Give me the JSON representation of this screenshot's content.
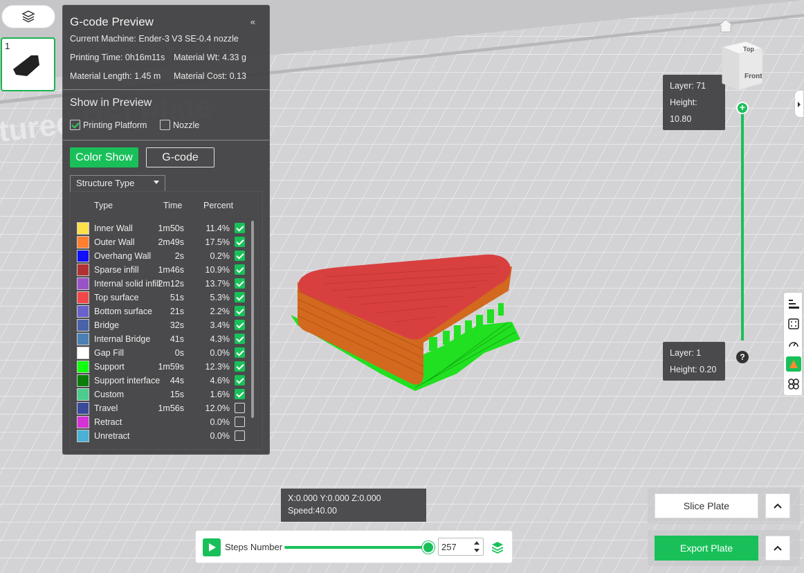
{
  "panel": {
    "title": "G-code Preview",
    "collapse": "«",
    "machine": "Current Machine: Ender-3 V3 SE-0.4 nozzle",
    "printing_time": "Printing Time: 0h16m11s",
    "material_wt": "Material Wt: 4.33 g",
    "material_length": "Material Length: 1.45 m",
    "material_cost": "Material Cost: 0.13",
    "show_in_preview": "Show in Preview",
    "opt_platform": "Printing Platform",
    "opt_nozzle": "Nozzle",
    "btn_color_show": "Color Show",
    "btn_gcode": "G-code",
    "select_value": "Structure Type",
    "hdr_type": "Type",
    "hdr_time": "Time",
    "hdr_percent": "Percent",
    "rows": [
      {
        "name": "Inner Wall",
        "time": "1m50s",
        "pct": "11.4%",
        "color": "#ffe04a",
        "on": true
      },
      {
        "name": "Outer Wall",
        "time": "2m49s",
        "pct": "17.5%",
        "color": "#ff7f2e",
        "on": true
      },
      {
        "name": "Overhang Wall",
        "time": "2s",
        "pct": "0.2%",
        "color": "#1010ff",
        "on": true
      },
      {
        "name": "Sparse infill",
        "time": "1m46s",
        "pct": "10.9%",
        "color": "#b03232",
        "on": true
      },
      {
        "name": "Internal solid infill",
        "time": "2m12s",
        "pct": "13.7%",
        "color": "#9a52c8",
        "on": true
      },
      {
        "name": "Top surface",
        "time": "51s",
        "pct": "5.3%",
        "color": "#f04848",
        "on": true
      },
      {
        "name": "Bottom surface",
        "time": "21s",
        "pct": "2.2%",
        "color": "#6a62cc",
        "on": true
      },
      {
        "name": "Bridge",
        "time": "32s",
        "pct": "3.4%",
        "color": "#4a62a8",
        "on": true
      },
      {
        "name": "Internal Bridge",
        "time": "41s",
        "pct": "4.3%",
        "color": "#4a80b4",
        "on": true
      },
      {
        "name": "Gap Fill",
        "time": "0s",
        "pct": "0.0%",
        "color": "#ffffff",
        "on": true
      },
      {
        "name": "Support",
        "time": "1m59s",
        "pct": "12.3%",
        "color": "#10ff10",
        "on": true
      },
      {
        "name": "Support interface",
        "time": "44s",
        "pct": "4.6%",
        "color": "#0a7d0a",
        "on": true
      },
      {
        "name": "Custom",
        "time": "15s",
        "pct": "1.6%",
        "color": "#4ccc8c",
        "on": true
      },
      {
        "name": "Travel",
        "time": "1m56s",
        "pct": "12.0%",
        "color": "#3a4a9a",
        "on": false
      },
      {
        "name": "Retract",
        "time": "",
        "pct": "0.0%",
        "color": "#d632d6",
        "on": false
      },
      {
        "name": "Unretract",
        "time": "",
        "pct": "0.0%",
        "color": "#4ab0d4",
        "on": false
      }
    ]
  },
  "thumb": {
    "number": "1"
  },
  "plate_text": "tured PEI Plate",
  "layer_top": {
    "layer": "Layer: 71",
    "height": "Height: 10.80"
  },
  "layer_bottom": {
    "layer": "Layer: 1",
    "height": "Height: 0.20"
  },
  "help": "?",
  "cube": {
    "top": "Top",
    "front": "Front"
  },
  "coords": {
    "line1": "X:0.000  Y:0.000  Z:0.000",
    "line2": "Speed:40.00"
  },
  "steps": {
    "label": "Steps Number",
    "value": "257"
  },
  "buttons": {
    "slice": "Slice Plate",
    "export": "Export Plate"
  },
  "colors": {
    "accent": "#19c05a",
    "panel": "#3e3e40"
  }
}
